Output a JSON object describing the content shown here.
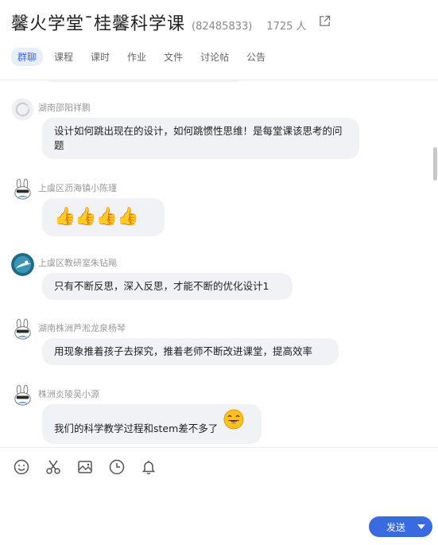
{
  "header": {
    "title": "馨火学堂¯桂馨科学课",
    "group_id": "(82485833)",
    "member_count": "1725 人",
    "tabs": [
      "群聊",
      "课程",
      "课时",
      "作业",
      "文件",
      "讨论帖",
      "公告"
    ]
  },
  "messages": [
    {
      "sender": "湖南邵阳祥鹏",
      "text": "设计如何跳出现在的设计，如何跳惯性思维！是每堂课该思考的问题",
      "avatar_icon": "ring-avatar"
    },
    {
      "sender": "上虞区沥海镇小陈瑾",
      "text": "👍👍👍👍",
      "avatar_icon": "rabbit-avatar"
    },
    {
      "sender": "上虞区教研室朱钻飚",
      "text": "只有不断反思，深入反思，才能不断的优化设计1",
      "avatar_icon": "sea-avatar"
    },
    {
      "sender": "湖南株洲芦淞龙泉杨琴",
      "text": "用现象推着孩子去探究，推着老师不断改进课堂，提高效率",
      "avatar_icon": "rabbit-avatar"
    },
    {
      "sender": "株洲炎陵吴小源",
      "text": "我们的科学教学过程和stem差不多了",
      "avatar_icon": "rabbit-avatar",
      "emoji": "grin-emoji"
    }
  ],
  "composer": {
    "tools": [
      "smiley-icon",
      "scissors-icon",
      "image-icon",
      "clock-icon",
      "bell-icon"
    ],
    "send_label": "发送"
  },
  "colors": {
    "accent": "#3a6ae0",
    "bubble": "#f1f2f5"
  }
}
